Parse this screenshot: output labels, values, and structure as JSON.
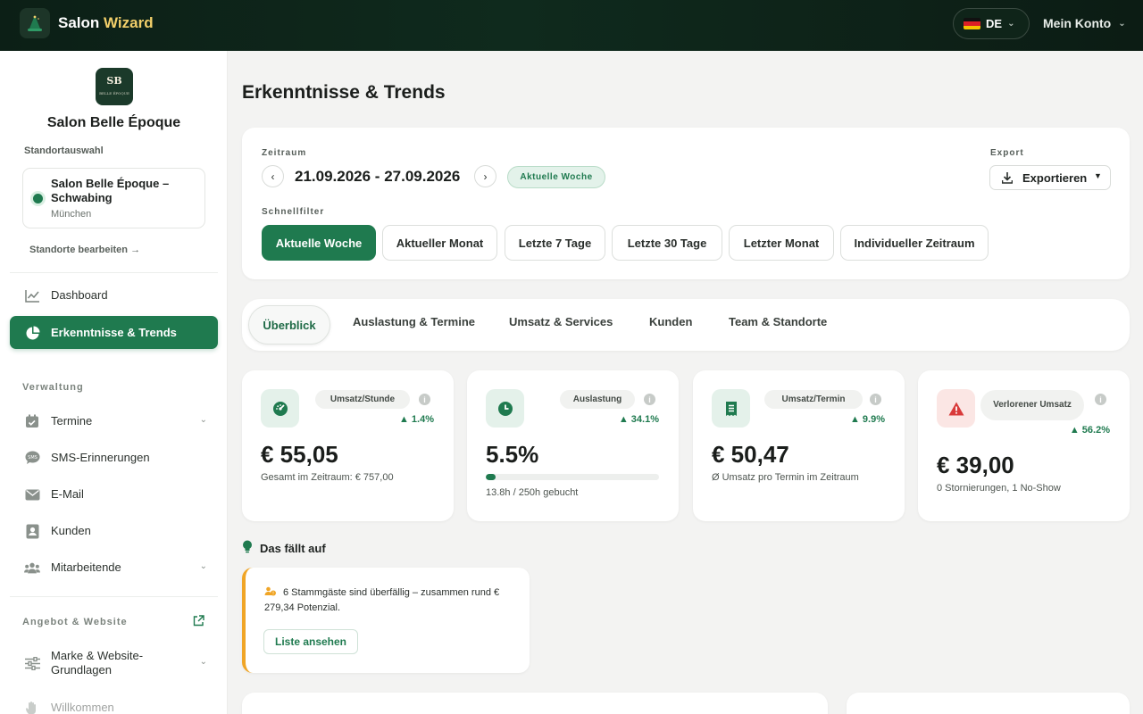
{
  "app": {
    "brand_main": "Salon",
    "brand_accent": "Wizard"
  },
  "topbar": {
    "language": "DE",
    "account": "Mein Konto"
  },
  "sidebar": {
    "salon_logo_initials": "SB",
    "salon_logo_sub": "BELLE ÉPOQUE",
    "salon_name": "Salon Belle Époque",
    "location_label": "Standortauswahl",
    "location": {
      "name": "Salon Belle Époque – Schwabing",
      "city": "München"
    },
    "edit_locations": "Standorte bearbeiten",
    "edit_locations_arrow": "→",
    "nav": [
      {
        "label": "Dashboard",
        "icon": "chart-line-icon"
      },
      {
        "label": "Erkenntnisse & Trends",
        "icon": "pie-chart-icon",
        "active": true
      }
    ],
    "section_admin": "Verwaltung",
    "admin_items": [
      {
        "label": "Termine",
        "icon": "calendar-check-icon"
      },
      {
        "label": "SMS-Erinnerungen",
        "icon": "sms-bubble-icon"
      },
      {
        "label": "E-Mail",
        "icon": "envelope-icon"
      },
      {
        "label": "Kunden",
        "icon": "contact-card-icon"
      },
      {
        "label": "Mitarbeitende",
        "icon": "users-icon"
      }
    ],
    "section_offer": "Angebot & Website",
    "offer_items": [
      {
        "label": "Marke & Website-Grundlagen",
        "icon": "sliders-icon"
      },
      {
        "label": "Willkommen",
        "icon": "hand-icon"
      }
    ]
  },
  "main": {
    "title": "Erkenntnisse & Trends",
    "filters": {
      "period_label": "Zeitraum",
      "date_range": "21.09.2026 - 27.09.2026",
      "current_badge": "Aktuelle Woche",
      "export_label": "Export",
      "export_button": "Exportieren",
      "quick_label": "Schnellfilter",
      "chips": [
        "Aktuelle Woche",
        "Aktueller Monat",
        "Letzte 7 Tage",
        "Letzte 30 Tage",
        "Letzter Monat",
        "Individueller Zeitraum"
      ]
    },
    "tabs": [
      "Überblick",
      "Auslastung & Termine",
      "Umsatz & Services",
      "Kunden",
      "Team & Standorte"
    ],
    "kpis": [
      {
        "label": "Umsatz/Stunde",
        "delta": "1.4%",
        "value": "€ 55,05",
        "sub": "Gesamt im Zeitraum: € 757,00",
        "icon": "speedometer-icon"
      },
      {
        "label": "Auslastung",
        "delta": "34.1%",
        "value": "5.5%",
        "sub": "13.8h / 250h gebucht",
        "progress": 0.055,
        "icon": "clock-icon"
      },
      {
        "label": "Umsatz/Termin",
        "delta": "9.9%",
        "value": "€ 50,47",
        "sub": "Ø Umsatz pro Termin im Zeitraum",
        "icon": "receipt-icon"
      },
      {
        "label": "Verlorener Umsatz",
        "delta": "56.2%",
        "value": "€ 39,00",
        "sub": "0 Stornierungen, 1 No-Show",
        "icon": "warning-icon"
      }
    ],
    "notice": {
      "heading": "Das fällt auf",
      "text": "6 Stammgäste sind überfällig – zusammen rund € 279,34 Potenzial.",
      "button": "Liste ansehen"
    }
  },
  "colors": {
    "primary": "#1f7a4f",
    "topbar": "#0f2a1d",
    "accent_gold": "#f2cf6a",
    "warning": "#f0a526",
    "danger": "#d93a3a"
  }
}
